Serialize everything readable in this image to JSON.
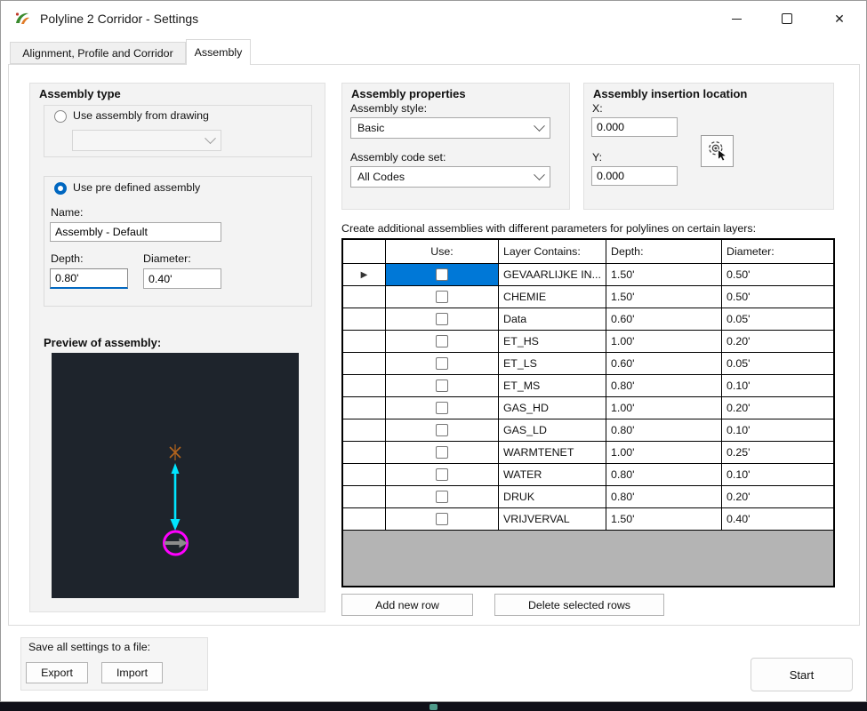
{
  "window": {
    "title": "Polyline 2 Corridor - Settings",
    "icons": {
      "close": "✕"
    }
  },
  "tabs": {
    "items": [
      {
        "label": "Alignment, Profile and Corridor",
        "active": false
      },
      {
        "label": "Assembly",
        "active": true
      }
    ]
  },
  "assembly_type": {
    "title": "Assembly type",
    "use_drawing_label": "Use assembly from drawing",
    "drawing_combo_value": "",
    "use_predefined_label": "Use pre defined assembly",
    "name_label": "Name:",
    "name_value": "Assembly - Default",
    "depth_label": "Depth:",
    "depth_value": "0.80'",
    "diameter_label": "Diameter:",
    "diameter_value": "0.40'",
    "preview_label": "Preview of assembly:"
  },
  "assembly_properties": {
    "title": "Assembly properties",
    "style_label": "Assembly style:",
    "style_value": "Basic",
    "code_set_label": "Assembly code set:",
    "code_set_value": "All Codes"
  },
  "insertion": {
    "title": "Assembly insertion location",
    "x_label": "X:",
    "x_value": "0.000",
    "y_label": "Y:",
    "y_value": "0.000"
  },
  "layers": {
    "caption": "Create additional assemblies with different parameters for polylines on certain layers:",
    "headers": [
      "Use:",
      "Layer Contains:",
      "Depth:",
      "Diameter:"
    ],
    "rows": [
      {
        "layer": "GEVAARLIJKE IN...",
        "depth": "1.50'",
        "diameter": "0.50'",
        "checked": false,
        "selected": true
      },
      {
        "layer": "CHEMIE",
        "depth": "1.50'",
        "diameter": "0.50'",
        "checked": false,
        "selected": false
      },
      {
        "layer": "Data",
        "depth": "0.60'",
        "diameter": "0.05'",
        "checked": false,
        "selected": false
      },
      {
        "layer": "ET_HS",
        "depth": "1.00'",
        "diameter": "0.20'",
        "checked": false,
        "selected": false
      },
      {
        "layer": "ET_LS",
        "depth": "0.60'",
        "diameter": "0.05'",
        "checked": false,
        "selected": false
      },
      {
        "layer": "ET_MS",
        "depth": "0.80'",
        "diameter": "0.10'",
        "checked": false,
        "selected": false
      },
      {
        "layer": "GAS_HD",
        "depth": "1.00'",
        "diameter": "0.20'",
        "checked": false,
        "selected": false
      },
      {
        "layer": "GAS_LD",
        "depth": "0.80'",
        "diameter": "0.10'",
        "checked": false,
        "selected": false
      },
      {
        "layer": "WARMTENET",
        "depth": "1.00'",
        "diameter": "0.25'",
        "checked": false,
        "selected": false
      },
      {
        "layer": "WATER",
        "depth": "0.80'",
        "diameter": "0.10'",
        "checked": false,
        "selected": false
      },
      {
        "layer": "DRUK",
        "depth": "0.80'",
        "diameter": "0.20'",
        "checked": false,
        "selected": false
      },
      {
        "layer": "VRIJVERVAL",
        "depth": "1.50'",
        "diameter": "0.40'",
        "checked": false,
        "selected": false
      }
    ],
    "add_button": "Add new row",
    "delete_button": "Delete selected rows"
  },
  "save": {
    "title": "Save all settings to a file:",
    "export_button": "Export",
    "import_button": "Import"
  },
  "footer": {
    "start_button": "Start"
  },
  "colors": {
    "selection": "#0078d7",
    "accent": "#0067c0",
    "preview_background": "#1e242c",
    "depth_arrow": "#00e5ff",
    "pipe_circle": "#ff00ff",
    "diameter_arrow": "#8c8c8c"
  }
}
